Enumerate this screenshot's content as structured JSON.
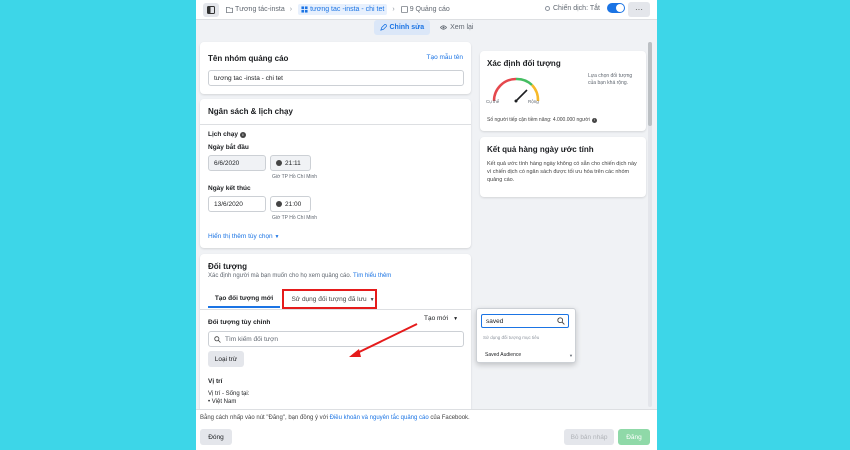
{
  "topbar": {
    "crumb1": "Tương tác-insta",
    "crumb2": "tương tac -insta - chi tet",
    "crumb3": "9 Quảng cáo",
    "status_label": "Chiến dịch: Tắt",
    "more": "···"
  },
  "modes": {
    "edit": "Chỉnh sửa",
    "review": "Xem lại"
  },
  "adset_name": {
    "title": "Tên nhóm quảng cáo",
    "template_link": "Tạo mẫu tên",
    "value": "tương tac -insta - chi tet"
  },
  "budget": {
    "title": "Ngân sách & lịch chạy",
    "schedule_label": "Lịch chạy",
    "start_label": "Ngày bắt đầu",
    "start_date": "6/6/2020",
    "start_time": "21:11",
    "start_tz": "Giờ TP Hồ Chí Minh",
    "end_label": "Ngày kết thúc",
    "end_date": "13/6/2020",
    "end_time": "21:00",
    "end_tz": "Giờ TP Hồ Chí Minh",
    "more_options": "Hiển thị thêm tùy chọn"
  },
  "audience": {
    "title": "Đối tượng",
    "desc": "Xác định người mà bạn muốn cho họ xem quảng cáo.",
    "learn_more": "Tìm hiểu thêm",
    "tab_new": "Tạo đối tượng mới",
    "tab_saved": "Sử dụng đối tượng đã lưu",
    "custom_label": "Đối tượng tùy chỉnh",
    "create_new": "Tạo mới",
    "search_placeholder": "Tìm kiếm đối tượn",
    "exclude": "Loại trừ",
    "location_label": "Vị trí",
    "location_sub": "Vị trí - Sống tại:",
    "location_item": "Việt Nam"
  },
  "dropdown": {
    "query": "saved",
    "hint": "Sử dụng đối tượng mục tiêu",
    "option": "Saved Audience"
  },
  "definition": {
    "title": "Xác định đối tượng",
    "gauge_left": "Cụ thể",
    "gauge_right": "Rộng",
    "gauge_note": "Lựa chọn đối tượng của bạn khá rộng.",
    "reach": "Số người tiếp cận tiềm năng: 4.000.000 người"
  },
  "daily": {
    "title": "Kết quả hàng ngày ước tính",
    "text": "Kết quả ước tính hàng ngày không có sẵn cho chiến dịch này vì chiến dịch có ngân sách được tối ưu hóa trên các nhóm quảng cáo."
  },
  "footer": {
    "terms_prefix": "Bằng cách nhấp vào nút \"Đăng\", bạn đồng ý với ",
    "terms_link": "Điều khoản và nguyên tắc quảng cáo",
    "terms_suffix": " của Facebook.",
    "close": "Đóng",
    "draft": "Bỏ bản nháp",
    "publish": "Đăng"
  },
  "colors": {
    "accent": "#1b74e4",
    "highlight": "#e51b1b",
    "publish": "#8fd9a8",
    "backdrop": "#3dd6e8"
  }
}
